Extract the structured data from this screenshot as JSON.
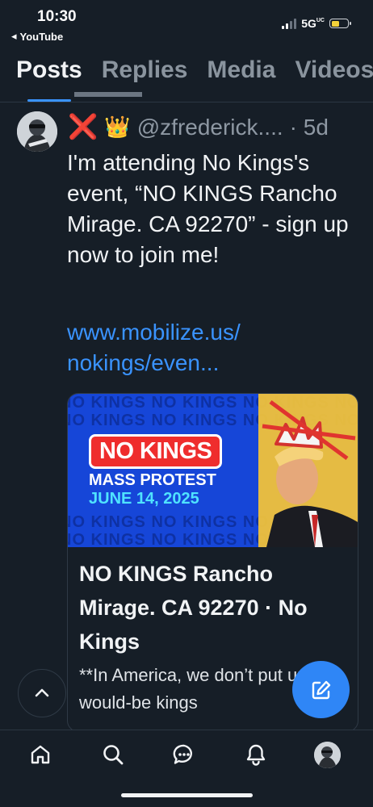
{
  "status_bar": {
    "time": "10:30",
    "back_app": "YouTube",
    "network": "5G",
    "network_suffix": "UC"
  },
  "tabs": [
    {
      "label": "Posts",
      "active": true
    },
    {
      "label": "Replies",
      "active": false
    },
    {
      "label": "Media",
      "active": false
    },
    {
      "label": "Videos",
      "active": false
    }
  ],
  "post": {
    "status_emoji": "❌",
    "crown_emoji": "👑",
    "handle": "@zfrederick....",
    "age": "· 5d",
    "text": "I'm attending No Kings's event, “NO KINGS Rancho Mirage. CA 92270” - sign up now to join me!",
    "link_line1": "www.mobilize.us/",
    "link_line2": "nokings/even..."
  },
  "card": {
    "banner": {
      "badge": "NO KINGS",
      "line1": "MASS PROTEST",
      "line2": "JUNE 14, 2025",
      "bg_text": "NO KINGS NO KINGS NO KINGS NO KINGS"
    },
    "title": "NO KINGS Rancho Mirage. CA 92270 · No Kings",
    "description": "**In America, we don’t put up with would-be kings"
  },
  "colors": {
    "background": "#161e27",
    "accent": "#3a93ff",
    "compose_button": "#2f86f6",
    "banner_blue": "#1646d8",
    "badge_red": "#ef2d2d"
  },
  "icons": {
    "nav": [
      "home-icon",
      "search-icon",
      "chat-icon",
      "bell-icon",
      "profile-avatar"
    ],
    "compose": "compose-icon",
    "scroll_top": "chevron-up-icon"
  }
}
